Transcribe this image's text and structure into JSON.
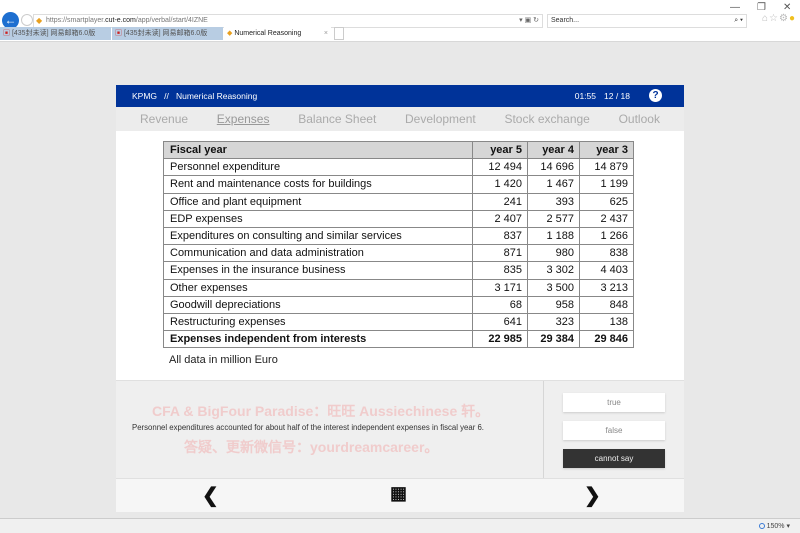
{
  "browser": {
    "url_host_prefix": "https://smartplayer.",
    "url_host": "cut-e.com",
    "url_path": "/app/verbal/start/4IZNE",
    "search_placeholder": "Search...",
    "tabs": [
      {
        "label": "[435封未读] 网易邮箱6.0版"
      },
      {
        "label": "[435封未读] 网易邮箱6.0版"
      },
      {
        "label": "Numerical Reasoning",
        "active": true
      }
    ],
    "zoom": "150%"
  },
  "header": {
    "brand": "KPMG",
    "separator": "//",
    "title": "Numerical Reasoning",
    "timer": "01:55",
    "progress": "12 / 18"
  },
  "nav_tabs": [
    {
      "label": "Revenue"
    },
    {
      "label": "Expenses",
      "active": true
    },
    {
      "label": "Balance Sheet"
    },
    {
      "label": "Development"
    },
    {
      "label": "Stock exchange"
    },
    {
      "label": "Outlook"
    }
  ],
  "table": {
    "headers": [
      "Fiscal year",
      "year 5",
      "year 4",
      "year 3"
    ],
    "rows": [
      [
        "Personnel expenditure",
        "12 494",
        "14 696",
        "14 879"
      ],
      [
        "Rent and maintenance costs for buildings",
        "1 420",
        "1 467",
        "1 199"
      ],
      [
        "Office and plant equipment",
        "241",
        "393",
        "625"
      ],
      [
        "EDP expenses",
        "2 407",
        "2 577",
        "2 437"
      ],
      [
        "Expenditures on consulting and similar services",
        "837",
        "1 188",
        "1 266"
      ],
      [
        "Communication and data administration",
        "871",
        "980",
        "838"
      ],
      [
        "Expenses in the insurance business",
        "835",
        "3 302",
        "4 403"
      ],
      [
        "Other expenses",
        "3 171",
        "3 500",
        "3 213"
      ],
      [
        "Goodwill depreciations",
        "68",
        "958",
        "848"
      ],
      [
        "Restructuring expenses",
        "641",
        "323",
        "138"
      ]
    ],
    "total": [
      "Expenses independent from interests",
      "22 985",
      "29 384",
      "29 846"
    ],
    "note": "All data in million Euro"
  },
  "question": {
    "statement": "Personnel expenditures accounted for about half of the interest independent expenses in fiscal year 6.",
    "watermark_line1": "CFA & BigFour Paradise：旺旺 Aussiechinese 轩。",
    "watermark_line2": "答疑、更新微信号：yourdreamcareer。",
    "options": [
      "true",
      "false",
      "cannot say"
    ],
    "selected": "cannot say"
  },
  "colors": {
    "header": "#003399",
    "selected_button": "#333333"
  }
}
